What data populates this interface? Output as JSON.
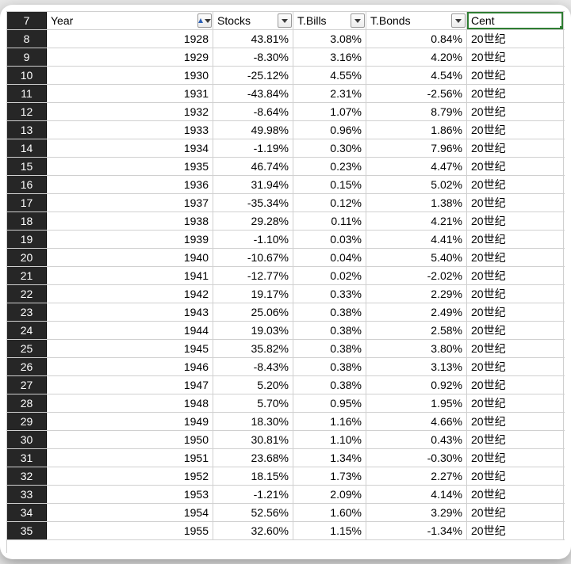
{
  "header_row_number": 7,
  "columns": {
    "year": {
      "label": "Year",
      "filter": true,
      "sort_asc": true
    },
    "stocks": {
      "label": "Stocks",
      "filter": true,
      "sort_asc": false
    },
    "tbills": {
      "label": "T.Bills",
      "filter": true,
      "sort_asc": false
    },
    "tbonds": {
      "label": "T.Bonds",
      "filter": true,
      "sort_asc": false
    },
    "cent": {
      "label": "Cent",
      "filter": false,
      "active": true
    }
  },
  "rows": [
    {
      "n": 8,
      "year": "1928",
      "stocks": "43.81%",
      "tbills": "3.08%",
      "tbonds": "0.84%",
      "cent": "20世纪"
    },
    {
      "n": 9,
      "year": "1929",
      "stocks": "-8.30%",
      "tbills": "3.16%",
      "tbonds": "4.20%",
      "cent": "20世纪"
    },
    {
      "n": 10,
      "year": "1930",
      "stocks": "-25.12%",
      "tbills": "4.55%",
      "tbonds": "4.54%",
      "cent": "20世纪"
    },
    {
      "n": 11,
      "year": "1931",
      "stocks": "-43.84%",
      "tbills": "2.31%",
      "tbonds": "-2.56%",
      "cent": "20世纪"
    },
    {
      "n": 12,
      "year": "1932",
      "stocks": "-8.64%",
      "tbills": "1.07%",
      "tbonds": "8.79%",
      "cent": "20世纪"
    },
    {
      "n": 13,
      "year": "1933",
      "stocks": "49.98%",
      "tbills": "0.96%",
      "tbonds": "1.86%",
      "cent": "20世纪"
    },
    {
      "n": 14,
      "year": "1934",
      "stocks": "-1.19%",
      "tbills": "0.30%",
      "tbonds": "7.96%",
      "cent": "20世纪"
    },
    {
      "n": 15,
      "year": "1935",
      "stocks": "46.74%",
      "tbills": "0.23%",
      "tbonds": "4.47%",
      "cent": "20世纪"
    },
    {
      "n": 16,
      "year": "1936",
      "stocks": "31.94%",
      "tbills": "0.15%",
      "tbonds": "5.02%",
      "cent": "20世纪"
    },
    {
      "n": 17,
      "year": "1937",
      "stocks": "-35.34%",
      "tbills": "0.12%",
      "tbonds": "1.38%",
      "cent": "20世纪"
    },
    {
      "n": 18,
      "year": "1938",
      "stocks": "29.28%",
      "tbills": "0.11%",
      "tbonds": "4.21%",
      "cent": "20世纪"
    },
    {
      "n": 19,
      "year": "1939",
      "stocks": "-1.10%",
      "tbills": "0.03%",
      "tbonds": "4.41%",
      "cent": "20世纪"
    },
    {
      "n": 20,
      "year": "1940",
      "stocks": "-10.67%",
      "tbills": "0.04%",
      "tbonds": "5.40%",
      "cent": "20世纪"
    },
    {
      "n": 21,
      "year": "1941",
      "stocks": "-12.77%",
      "tbills": "0.02%",
      "tbonds": "-2.02%",
      "cent": "20世纪"
    },
    {
      "n": 22,
      "year": "1942",
      "stocks": "19.17%",
      "tbills": "0.33%",
      "tbonds": "2.29%",
      "cent": "20世纪"
    },
    {
      "n": 23,
      "year": "1943",
      "stocks": "25.06%",
      "tbills": "0.38%",
      "tbonds": "2.49%",
      "cent": "20世纪"
    },
    {
      "n": 24,
      "year": "1944",
      "stocks": "19.03%",
      "tbills": "0.38%",
      "tbonds": "2.58%",
      "cent": "20世纪"
    },
    {
      "n": 25,
      "year": "1945",
      "stocks": "35.82%",
      "tbills": "0.38%",
      "tbonds": "3.80%",
      "cent": "20世纪"
    },
    {
      "n": 26,
      "year": "1946",
      "stocks": "-8.43%",
      "tbills": "0.38%",
      "tbonds": "3.13%",
      "cent": "20世纪"
    },
    {
      "n": 27,
      "year": "1947",
      "stocks": "5.20%",
      "tbills": "0.38%",
      "tbonds": "0.92%",
      "cent": "20世纪"
    },
    {
      "n": 28,
      "year": "1948",
      "stocks": "5.70%",
      "tbills": "0.95%",
      "tbonds": "1.95%",
      "cent": "20世纪"
    },
    {
      "n": 29,
      "year": "1949",
      "stocks": "18.30%",
      "tbills": "1.16%",
      "tbonds": "4.66%",
      "cent": "20世纪"
    },
    {
      "n": 30,
      "year": "1950",
      "stocks": "30.81%",
      "tbills": "1.10%",
      "tbonds": "0.43%",
      "cent": "20世纪"
    },
    {
      "n": 31,
      "year": "1951",
      "stocks": "23.68%",
      "tbills": "1.34%",
      "tbonds": "-0.30%",
      "cent": "20世纪"
    },
    {
      "n": 32,
      "year": "1952",
      "stocks": "18.15%",
      "tbills": "1.73%",
      "tbonds": "2.27%",
      "cent": "20世纪"
    },
    {
      "n": 33,
      "year": "1953",
      "stocks": "-1.21%",
      "tbills": "2.09%",
      "tbonds": "4.14%",
      "cent": "20世纪"
    },
    {
      "n": 34,
      "year": "1954",
      "stocks": "52.56%",
      "tbills": "1.60%",
      "tbonds": "3.29%",
      "cent": "20世纪"
    },
    {
      "n": 35,
      "year": "1955",
      "stocks": "32.60%",
      "tbills": "1.15%",
      "tbonds": "-1.34%",
      "cent": "20世纪"
    }
  ]
}
